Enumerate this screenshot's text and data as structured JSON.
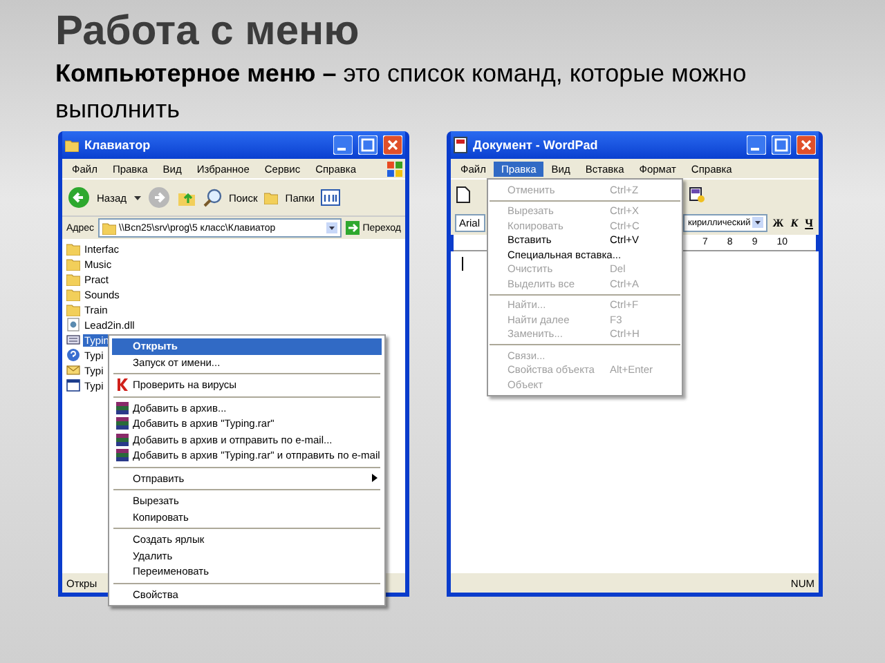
{
  "slide": {
    "title": "Работа с меню",
    "subtitle": "**Компьютерное меню –** это список команд, которые можно выполнить"
  },
  "explorer": {
    "title": "Клавиатор",
    "menu": [
      "Файл",
      "Правка",
      "Вид",
      "Избранное",
      "Сервис",
      "Справка"
    ],
    "back_label": "Назад",
    "search_label": "Поиск",
    "folders_label": "Папки",
    "address_label": "Адрес",
    "address": "\\\\Bcn25\\srv\\prog\\5 класс\\Клавиатор",
    "go_label": "Переход",
    "files": [
      {
        "label": "Interfac",
        "kind": "folder",
        "selected": false
      },
      {
        "label": "Music",
        "kind": "folder",
        "selected": false
      },
      {
        "label": "Pract",
        "kind": "folder",
        "selected": false
      },
      {
        "label": "Sounds",
        "kind": "folder",
        "selected": false
      },
      {
        "label": "Train",
        "kind": "folder",
        "selected": false
      },
      {
        "label": "Lead2in.dll",
        "kind": "dll",
        "selected": false
      },
      {
        "label": "Typin",
        "kind": "app",
        "selected": true
      },
      {
        "label": "Typi",
        "kind": "help",
        "selected": false
      },
      {
        "label": "Typi",
        "kind": "mail",
        "selected": false
      },
      {
        "label": "Typi",
        "kind": "window",
        "selected": false
      }
    ],
    "status": "Откры",
    "context_menu": [
      [
        {
          "label": "Открыть",
          "kind": "default",
          "selected": true
        },
        {
          "label": "Запуск от имени...",
          "kind": "plain",
          "selected": false
        }
      ],
      [
        {
          "label": "Проверить на вирусы",
          "kind": "antivirus",
          "selected": false
        }
      ],
      [
        {
          "label": "Добавить в архив...",
          "kind": "archive",
          "selected": false
        },
        {
          "label": "Добавить в архив \"Typing.rar\"",
          "kind": "archive",
          "selected": false
        },
        {
          "label": "Добавить в архив и отправить по e-mail...",
          "kind": "archive",
          "selected": false
        },
        {
          "label": "Добавить в архив \"Typing.rar\" и отправить по e-mail",
          "kind": "archive",
          "selected": false
        }
      ],
      [
        {
          "label": "Отправить",
          "kind": "submenu",
          "selected": false
        }
      ],
      [
        {
          "label": "Вырезать",
          "kind": "plain",
          "selected": false
        },
        {
          "label": "Копировать",
          "kind": "plain",
          "selected": false
        }
      ],
      [
        {
          "label": "Создать ярлык",
          "kind": "plain",
          "selected": false
        },
        {
          "label": "Удалить",
          "kind": "plain",
          "selected": false
        },
        {
          "label": "Переименовать",
          "kind": "plain",
          "selected": false
        }
      ],
      [
        {
          "label": "Свойства",
          "kind": "plain",
          "selected": false
        }
      ]
    ]
  },
  "wordpad": {
    "title": "Документ - WordPad",
    "menu": [
      {
        "label": "Файл",
        "selected": false
      },
      {
        "label": "Правка",
        "selected": true
      },
      {
        "label": "Вид",
        "selected": false
      },
      {
        "label": "Вставка",
        "selected": false
      },
      {
        "label": "Формат",
        "selected": false
      },
      {
        "label": "Справка",
        "selected": false
      }
    ],
    "font": "Arial",
    "script": "кириллический",
    "format_buttons": [
      "Ж",
      "К",
      "Ч"
    ],
    "ruler": [
      "7",
      "8",
      "9",
      "10"
    ],
    "edit_menu": [
      [
        {
          "label": "Отменить",
          "shortcut": "Ctrl+Z",
          "disabled": true
        }
      ],
      [
        {
          "label": "Вырезать",
          "shortcut": "Ctrl+X",
          "disabled": true
        },
        {
          "label": "Копировать",
          "shortcut": "Ctrl+C",
          "disabled": true
        },
        {
          "label": "Вставить",
          "shortcut": "Ctrl+V",
          "disabled": false
        },
        {
          "label": "Специальная вставка...",
          "disabled": false
        },
        {
          "label": "Очистить",
          "shortcut": "Del",
          "disabled": true
        },
        {
          "label": "Выделить все",
          "shortcut": "Ctrl+A",
          "disabled": true
        }
      ],
      [
        {
          "label": "Найти...",
          "shortcut": "Ctrl+F",
          "disabled": true
        },
        {
          "label": "Найти далее",
          "shortcut": "F3",
          "disabled": true
        },
        {
          "label": "Заменить...",
          "shortcut": "Ctrl+H",
          "disabled": true
        }
      ],
      [
        {
          "label": "Связи...",
          "disabled": true
        },
        {
          "label": "Свойства объекта",
          "shortcut": "Alt+Enter",
          "disabled": true
        },
        {
          "label": "Объект",
          "disabled": true
        }
      ]
    ],
    "status": "NUM"
  }
}
